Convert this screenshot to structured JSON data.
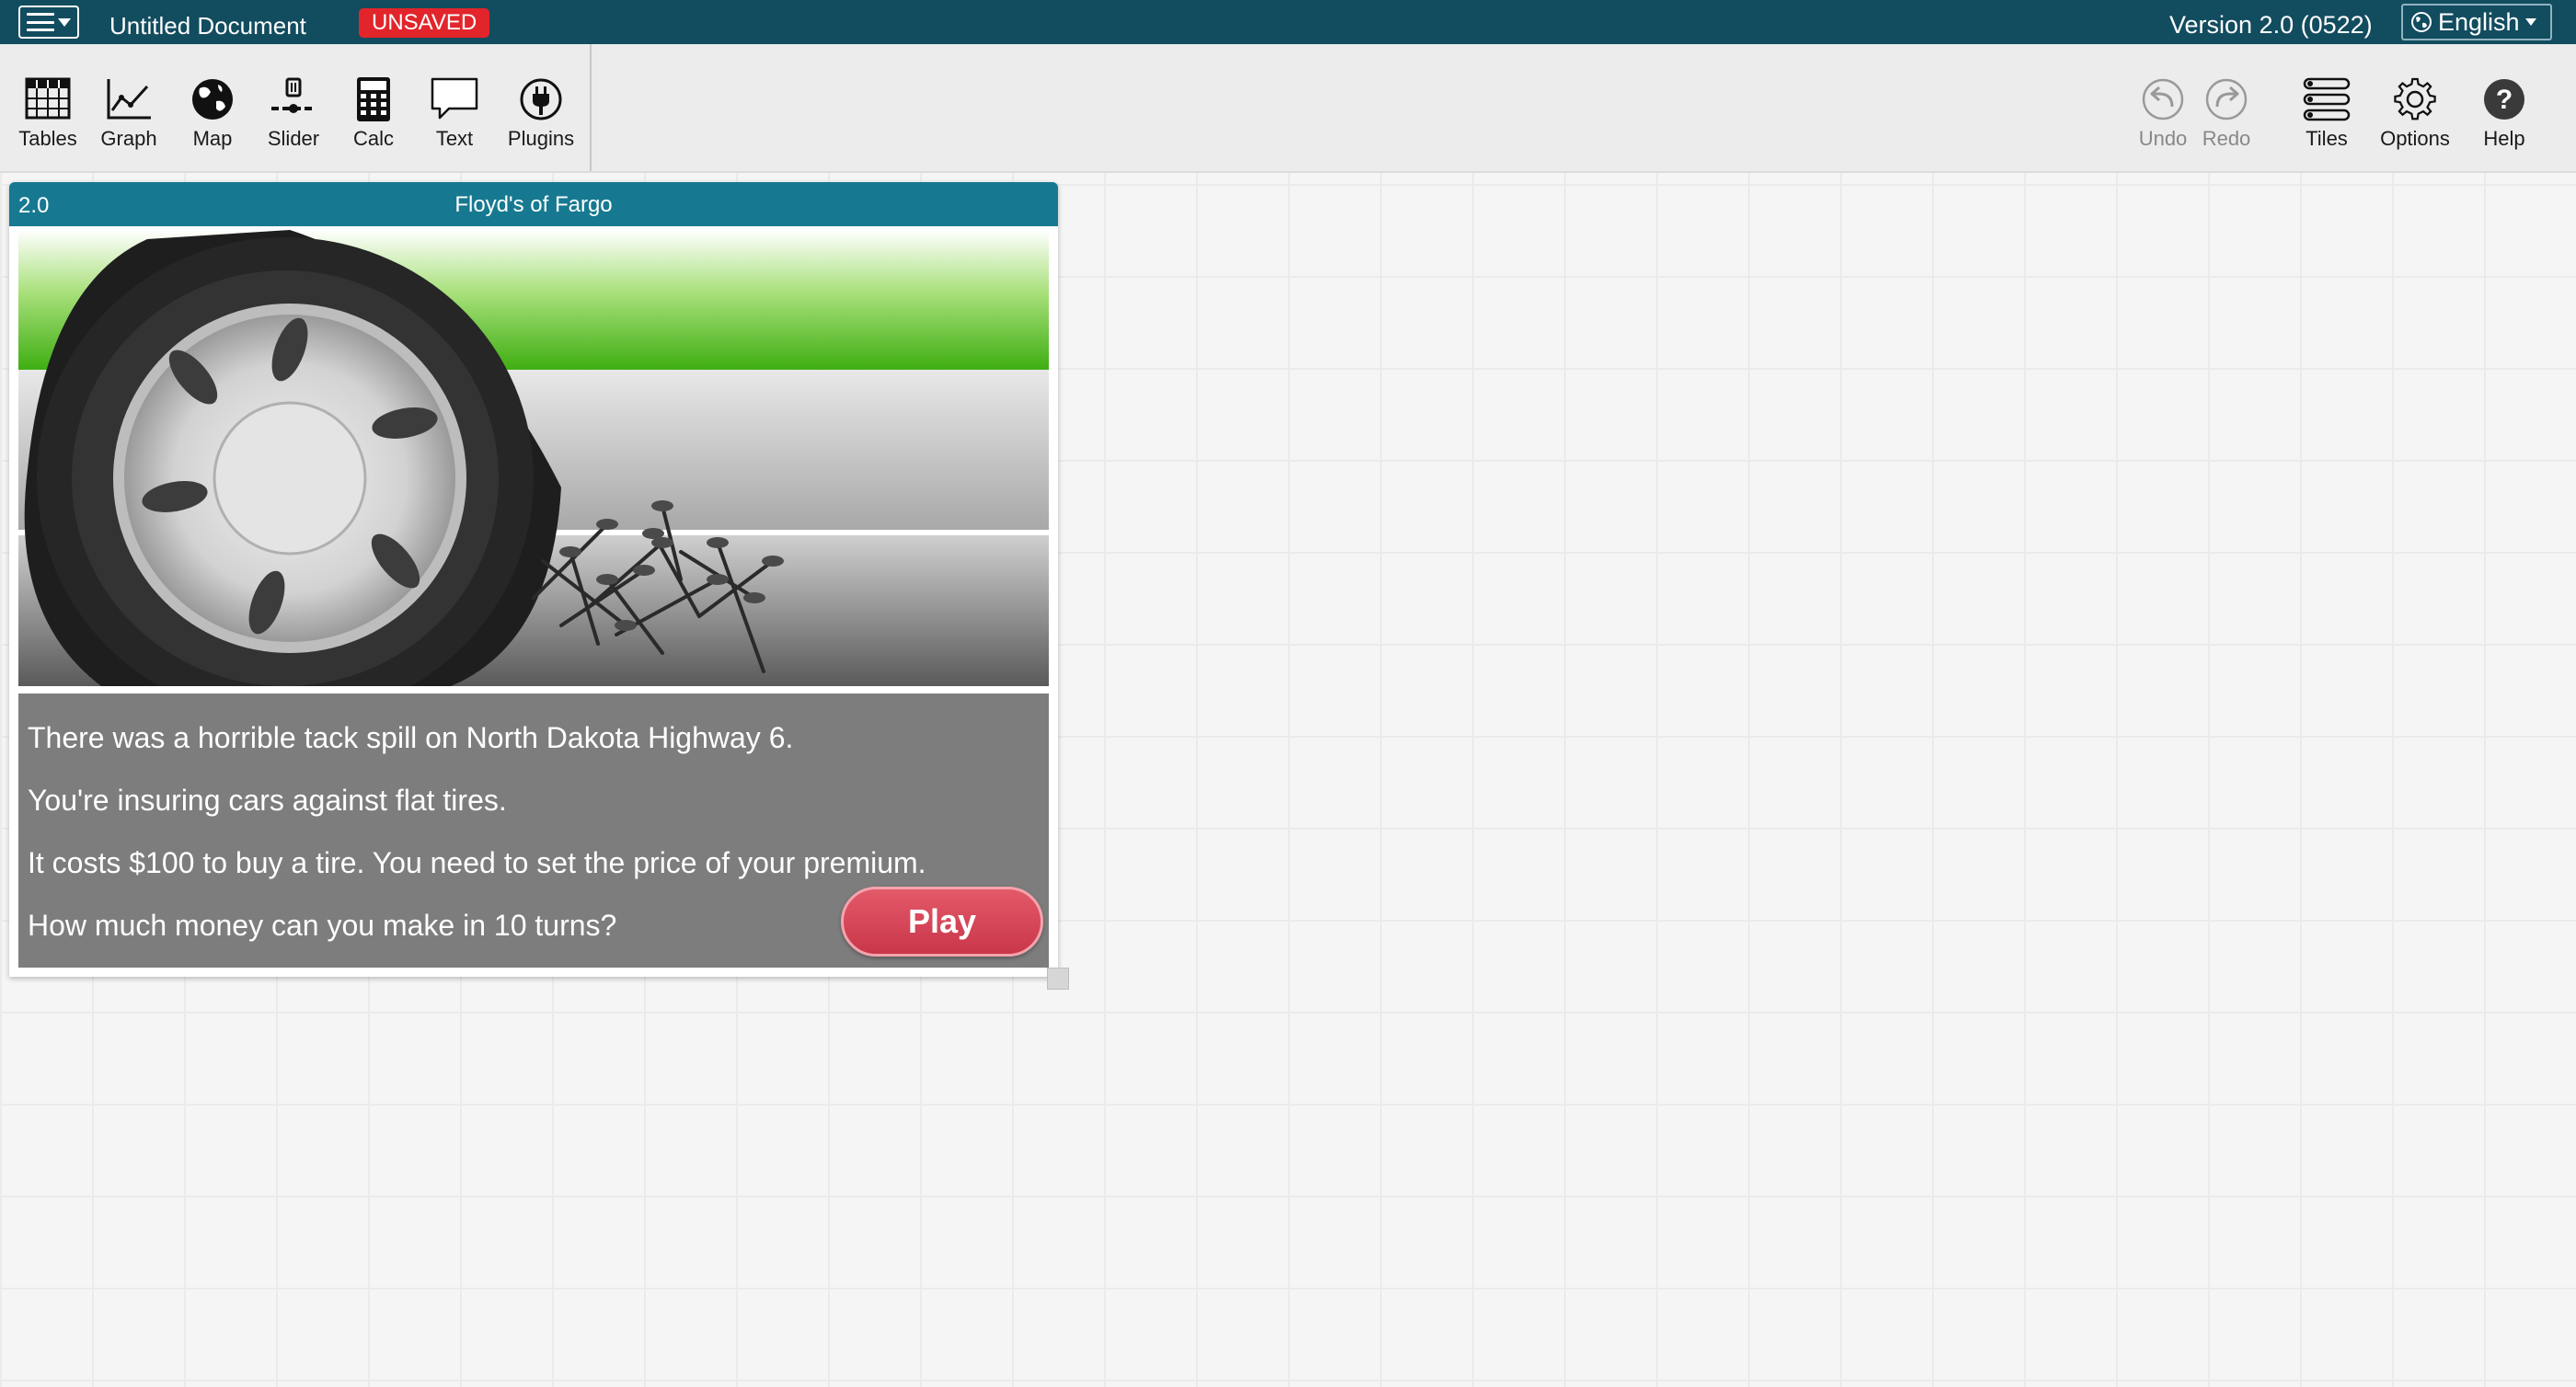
{
  "menubar": {
    "document_title": "Untitled Document",
    "unsaved_badge": "UNSAVED",
    "version": "Version 2.0 (0522)",
    "language": "English",
    "colors": {
      "background": "#124c5f",
      "badge": "#e2252b"
    }
  },
  "toolshelf": {
    "left_tools": [
      {
        "label": "Tables",
        "icon": "table-icon"
      },
      {
        "label": "Graph",
        "icon": "graph-icon"
      },
      {
        "label": "Map",
        "icon": "globe-icon"
      },
      {
        "label": "Slider",
        "icon": "slider-icon"
      },
      {
        "label": "Calc",
        "icon": "calculator-icon"
      },
      {
        "label": "Text",
        "icon": "speech-bubble-icon"
      },
      {
        "label": "Plugins",
        "icon": "plug-icon"
      }
    ],
    "right_tools": [
      {
        "label": "Undo",
        "icon": "undo-icon",
        "enabled": false
      },
      {
        "label": "Redo",
        "icon": "redo-icon",
        "enabled": false
      },
      {
        "label": "Tiles",
        "icon": "tiles-list-icon",
        "enabled": true
      },
      {
        "label": "Options",
        "icon": "gear-icon",
        "enabled": true
      },
      {
        "label": "Help",
        "icon": "help-icon",
        "enabled": true
      }
    ]
  },
  "tile": {
    "version": "2.0",
    "title": "Floyd's of Fargo",
    "titlebar_color": "#177991",
    "lines": [
      "There was a horrible tack spill on North Dakota Highway 6.",
      "You're insuring cars against flat tires.",
      "It costs $100 to buy a tire. You need to set the price of your premium.",
      "How much money can you make in 10 turns?"
    ],
    "play_label": "Play",
    "play_color": "#d6445a"
  }
}
